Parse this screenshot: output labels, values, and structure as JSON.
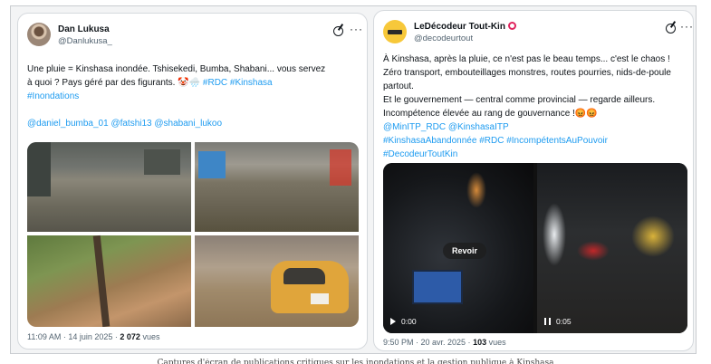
{
  "left_tweet": {
    "author_name": "Dan Lukusa",
    "handle": "@Danlukusa_",
    "text_line1": "Une pluie = Kinshasa inondée. Tshisekedi, Bumba, Shabani... vous servez",
    "text_line2_plain": "à quoi ? Pays géré par des figurants. 🤡🌧️ ",
    "hashtags_line2": "#RDC #Kinshasa",
    "hashtags_line3": "#Inondations",
    "mentions": "@daniel_bumba_01 @fatshi13 @shabani_lukoo",
    "time_date": "11:09 AM · 14 juin 2025 · ",
    "views_count": "2 072",
    "views_label": " vues"
  },
  "right_tweet": {
    "author_name": "LeDécodeur Tout-Kin",
    "handle": "@decodeurtout",
    "text_line1": "À Kinshasa, après la pluie, ce n'est pas le beau temps... c'est le chaos !",
    "text_line2": "Zéro transport, embouteillages monstres, routes pourries, nids-de-poule",
    "text_line3": "partout.",
    "text_line4": "Et le gouvernement — central comme provincial — regarde ailleurs.",
    "text_line5": "Incompétence élevée au rang de gouvernance !😡😡",
    "mentions": "@MinITP_RDC @KinshasaITP",
    "hashtags_line1": "#KinshasaAbandonnée #RDC #IncompétentsAuPouvoir",
    "hashtags_line2": "#DecodeurToutKin",
    "video1_time": "0:00",
    "video2_time": "0:05",
    "replay_label": "Revoir",
    "time_date": "9:50 PM · 20 avr. 2025 · ",
    "views_count": "103",
    "views_label": " vues"
  },
  "more_label": "···",
  "caption": "Captures d'écran de publications critiques sur les inondations et la gestion publique à Kinshasa"
}
